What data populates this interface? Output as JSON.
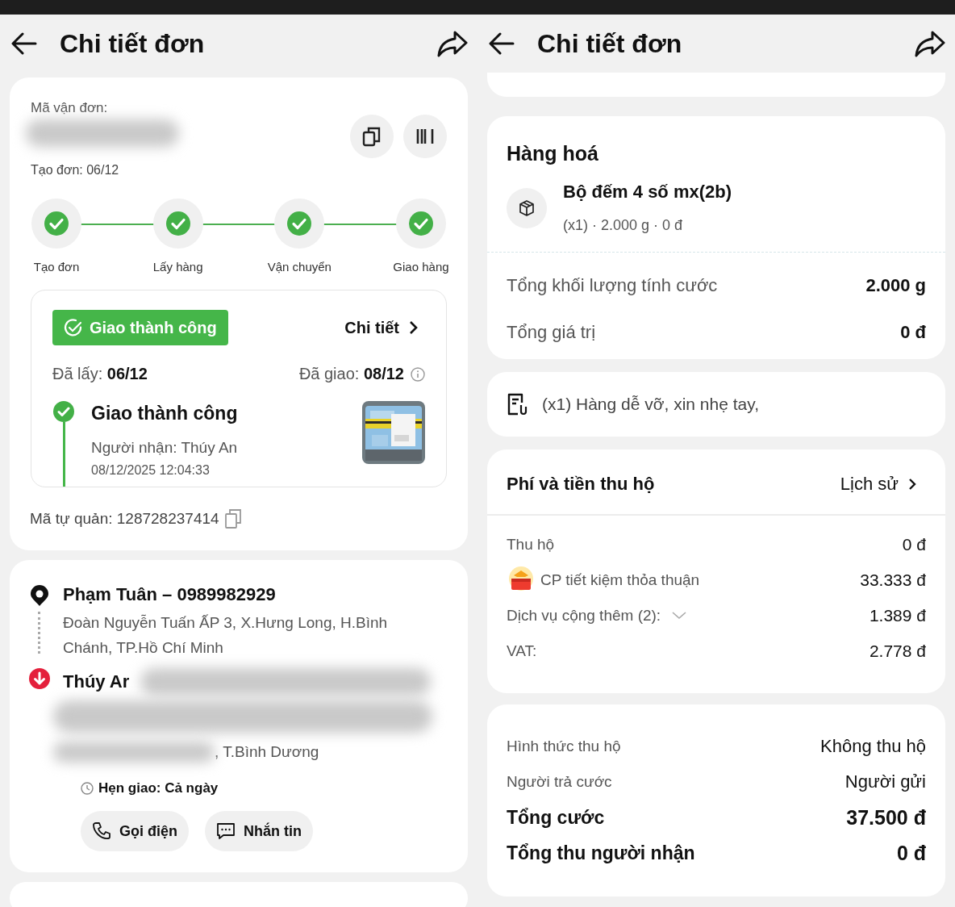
{
  "left_screen": {
    "title": "Chi tiết đơn",
    "order_card": {
      "code_label": "Mã vận đơn:",
      "created": "Tạo đơn: 06/12",
      "steps": [
        {
          "label": "Tạo đơn",
          "done": true
        },
        {
          "label": "Lấy hàng",
          "done": true
        },
        {
          "label": "Vận chuyển",
          "done": true
        },
        {
          "label": "Giao hàng",
          "done": true
        }
      ],
      "status": {
        "badge": "Giao thành công",
        "detail_link": "Chi tiết",
        "picked": "Đã lấy: **06/12**",
        "delivered": "Đã giao: **08/12**",
        "event": {
          "title": "Giao thành công",
          "recipient": "Người nhận: Thúy An",
          "time": "08/12/2025 12:04:33"
        }
      },
      "self_code": "Mã tự quản: 128728237414"
    },
    "address_card": {
      "sender": {
        "name": "Phạm Tuân – 0989982929",
        "address": "Đoàn Nguyễn Tuấn ẤP 3, X.Hưng Long, H.Bình Chánh, TP.Hồ Chí Minh"
      },
      "receiver": {
        "name": "Thúy Ar",
        "address": ", T.Bình Dương"
      },
      "schedule": "Hẹn giao: Cả ngày",
      "actions": [
        {
          "label": "Gọi điện",
          "kind": "call"
        },
        {
          "label": "Nhắn tin",
          "kind": "message"
        }
      ]
    }
  },
  "right_screen": {
    "title": "Chi tiết đơn",
    "goods": {
      "heading": "Hàng hoá",
      "item": {
        "name": "Bộ đếm 4 số mx(2b)",
        "meta": "(x1) · 2.000 g · 0 đ"
      },
      "totals": [
        {
          "label": "Tổng khối lượng tính cước",
          "value": "2.000 g"
        },
        {
          "label": "Tổng giá trị",
          "value": "0 đ"
        }
      ]
    },
    "note": "(x1) Hàng dễ vỡ, xin nhẹ tay,",
    "fees": {
      "heading": "Phí và tiền thu hộ",
      "history_link": "Lịch sử",
      "rows": [
        {
          "kind": "plain",
          "label": "Thu hộ",
          "value": "0 đ"
        },
        {
          "kind": "promo",
          "label": "CP tiết kiệm thỏa thuận",
          "value": "33.333 đ"
        },
        {
          "kind": "expandable",
          "label": "Dịch vụ cộng thêm (2):",
          "value": "1.389 đ"
        },
        {
          "kind": "plain",
          "label": "VAT:",
          "value": "2.778 đ"
        }
      ]
    },
    "summary": {
      "rows": [
        {
          "kind": "detail",
          "label": "Hình thức thu hộ",
          "value": "Không thu hộ"
        },
        {
          "kind": "detail",
          "label": "Người trả cước",
          "value": "Người gửi"
        },
        {
          "kind": "total",
          "label": "Tổng cước",
          "value": "37.500 đ"
        },
        {
          "kind": "total",
          "label": "Tổng thu người nhận",
          "value": "0 đ"
        }
      ]
    }
  }
}
